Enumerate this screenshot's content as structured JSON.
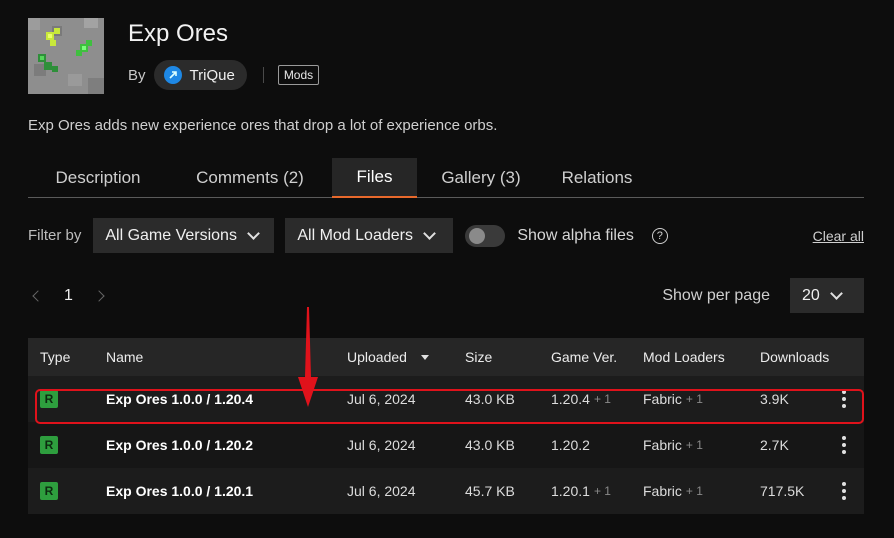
{
  "project": {
    "title": "Exp Ores",
    "by_label": "By",
    "author": "TriQue",
    "category_tag": "Mods",
    "summary": "Exp Ores adds new experience ores that drop a lot of experience orbs."
  },
  "tabs": [
    {
      "label": "Description",
      "active": false
    },
    {
      "label": "Comments (2)",
      "active": false
    },
    {
      "label": "Files",
      "active": true
    },
    {
      "label": "Gallery (3)",
      "active": false
    },
    {
      "label": "Relations",
      "active": false
    }
  ],
  "filters": {
    "label": "Filter by",
    "game_versions": "All Game Versions",
    "mod_loaders": "All Mod Loaders",
    "alpha_toggle_label": "Show alpha files",
    "alpha_enabled": false,
    "help_glyph": "?",
    "clear_all": "Clear all"
  },
  "pagination": {
    "current_page": "1",
    "per_page_label": "Show per page",
    "per_page_value": "20"
  },
  "table": {
    "headers": {
      "type": "Type",
      "name": "Name",
      "uploaded": "Uploaded",
      "size": "Size",
      "game_ver": "Game Ver.",
      "mod_loaders": "Mod Loaders",
      "downloads": "Downloads"
    },
    "rows": [
      {
        "type": "R",
        "name": "Exp Ores 1.0.0 / 1.20.4",
        "uploaded": "Jul 6, 2024",
        "size": "43.0 KB",
        "game_ver": "1.20.4",
        "game_ver_extra": "+ 1",
        "loader": "Fabric",
        "loader_extra": "+ 1",
        "downloads": "3.9K"
      },
      {
        "type": "R",
        "name": "Exp Ores 1.0.0 / 1.20.2",
        "uploaded": "Jul 6, 2024",
        "size": "43.0 KB",
        "game_ver": "1.20.2",
        "game_ver_extra": "",
        "loader": "Fabric",
        "loader_extra": "+ 1",
        "downloads": "2.7K"
      },
      {
        "type": "R",
        "name": "Exp Ores 1.0.0 / 1.20.1",
        "uploaded": "Jul 6, 2024",
        "size": "45.7 KB",
        "game_ver": "1.20.1",
        "game_ver_extra": "+ 1",
        "loader": "Fabric",
        "loader_extra": "+ 1",
        "downloads": "717.5K"
      }
    ]
  },
  "colors": {
    "accent_tab_underline": "#e8692c",
    "release_badge": "#2e9e3e",
    "annotation_red": "#e0121b"
  }
}
